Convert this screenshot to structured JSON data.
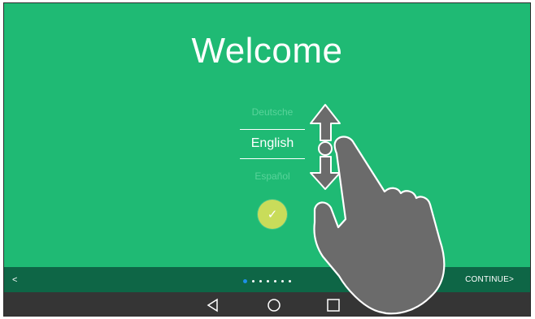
{
  "screen": {
    "title": "Welcome"
  },
  "language_picker": {
    "previous": "Deutsche",
    "selected": "English",
    "next": "Español",
    "confirm_icon": "check-icon"
  },
  "bottom_bar": {
    "back_label": "<",
    "continue_label": "CONTINUE>",
    "pager": {
      "total": 7,
      "active": 1
    }
  },
  "nav_bar": {
    "icons": [
      "triangle-back-icon",
      "circle-home-icon",
      "square-recents-icon"
    ]
  },
  "gesture_overlay": {
    "icon": "hand-swipe-up-down-icon"
  },
  "colors": {
    "background": "#1fba74",
    "bottom_bar": "#0e6646",
    "nav_bar": "#353535",
    "confirm": "#c9dc5a",
    "active_dot": "#1e90e6"
  }
}
